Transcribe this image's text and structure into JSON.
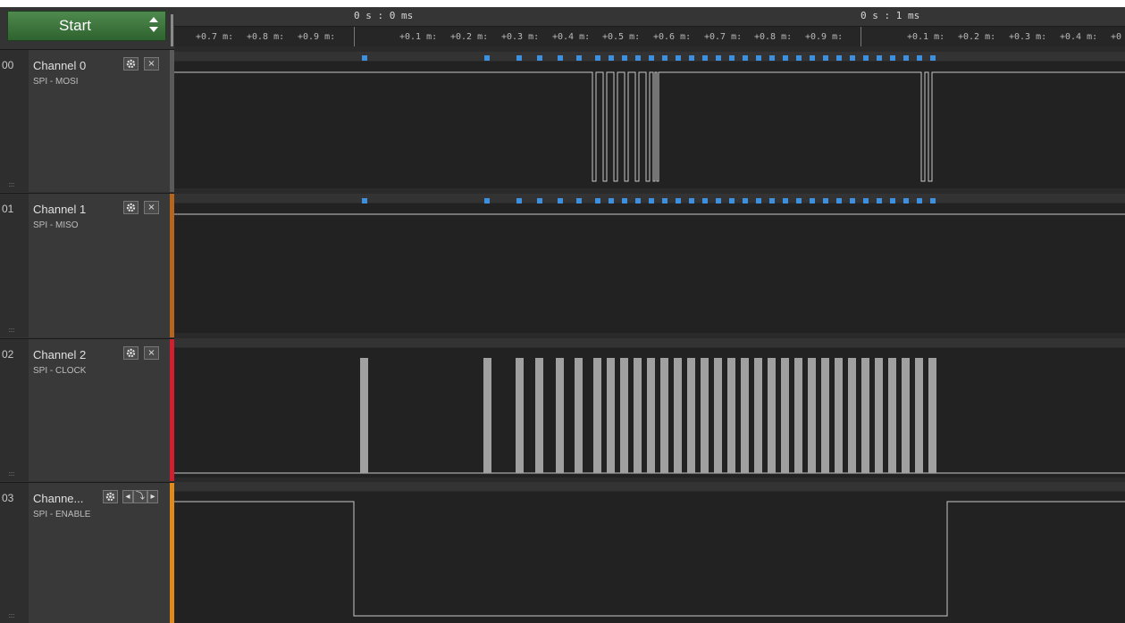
{
  "toolbar": {
    "start_label": "Start"
  },
  "ruler": {
    "major_labels": [
      "0 s : 0 ms",
      "0 s : 1 ms"
    ],
    "minor_labels_left": [
      "+0.7 m:",
      "+0.8 m:",
      "+0.9 m:"
    ],
    "minor_labels_mid": [
      "+0.1 m:",
      "+0.2 m:",
      "+0.3 m:",
      "+0.4 m:",
      "+0.5 m:",
      "+0.6 m:",
      "+0.7 m:",
      "+0.8 m:",
      "+0.9 m:"
    ],
    "minor_labels_right": [
      "+0.1 m:",
      "+0.2 m:",
      "+0.3 m:",
      "+0.4 m:",
      "+0"
    ]
  },
  "channels": [
    {
      "num": "00",
      "name": "Channel 0",
      "analyzer": "SPI - MOSI",
      "color": "#666666",
      "grip": "::::"
    },
    {
      "num": "01",
      "name": "Channel 1",
      "analyzer": "SPI - MISO",
      "color": "#b5651d",
      "grip": "::::"
    },
    {
      "num": "02",
      "name": "Channel 2",
      "analyzer": "SPI - CLOCK",
      "color": "#d02030",
      "grip": "::::"
    },
    {
      "num": "03",
      "name": "Channe...",
      "analyzer": "SPI - ENABLE",
      "color": "#e08a1c",
      "grip": "::::"
    }
  ],
  "buttons": {
    "close": "×",
    "prev": "◂",
    "edge": "⤵",
    "next": "▸"
  },
  "icons": {
    "settings": "gear-icon",
    "close": "close-icon",
    "trigger_prev": "prev-icon",
    "trigger_edge": "falling-edge-icon",
    "trigger_next": "next-icon"
  },
  "colors": {
    "packet": "#3d8fe0",
    "signal": "#c8c8c8",
    "start": "#3f7a3f"
  }
}
